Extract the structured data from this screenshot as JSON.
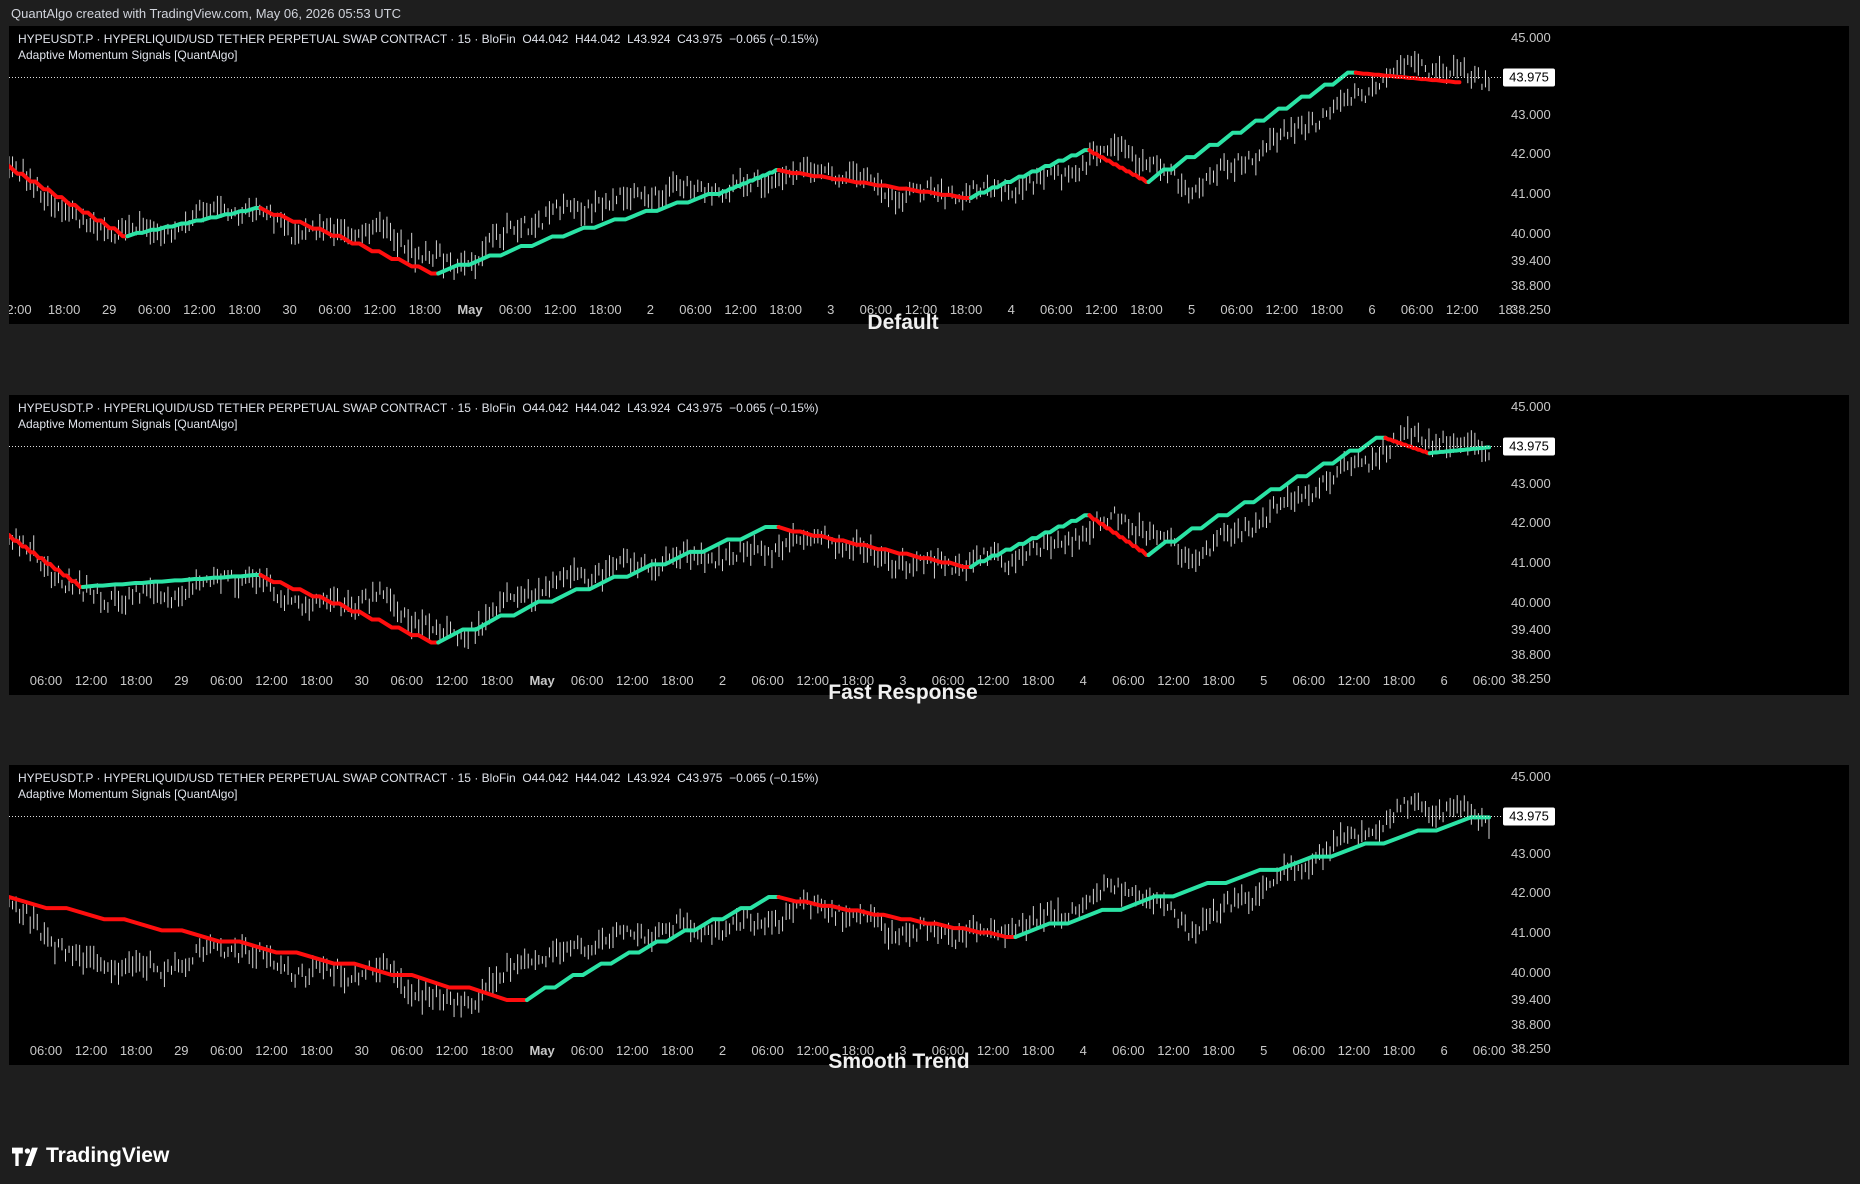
{
  "credit": "QuantAlgo created with TradingView.com, May 06, 2026 05:53 UTC",
  "brand": "TradingView",
  "colors": {
    "bull": "#2be3a5",
    "bear": "#ff0e0e",
    "price": "#d4d4d4",
    "background": "#000000"
  },
  "legend": {
    "symbol_line": "HYPEUSDT.P · HYPERLIQUID/USD TETHER PERPETUAL SWAP CONTRACT · 15 · BloFin  O44.042  H44.042  L43.924  C43.975  −0.065 (−0.15%)",
    "indicator_line": "Adaptive Momentum Signals [QuantAlgo]"
  },
  "chart_data": [
    {
      "type": "line",
      "title": "Default",
      "symbol": "HYPEUSDT.P",
      "timeframe": "15",
      "last_price": "43.975",
      "y_ticks": [
        "45.000",
        "43.000",
        "42.000",
        "41.000",
        "40.000",
        "39.400",
        "38.800",
        "38.250"
      ],
      "x_ticks": [
        "2:00",
        "18:00",
        "29",
        "06:00",
        "12:00",
        "18:00",
        "30",
        "06:00",
        "12:00",
        "18:00",
        "May",
        "06:00",
        "12:00",
        "18:00",
        "2",
        "06:00",
        "12:00",
        "18:00",
        "3",
        "06:00",
        "12:00",
        "18:00",
        "4",
        "06:00",
        "12:00",
        "18:00",
        "5",
        "06:00",
        "12:00",
        "18:00",
        "6",
        "06:00",
        "12:00",
        "18:"
      ],
      "price_series": {
        "name": "HYPEUSDT.P",
        "x": [
          0,
          0.05,
          0.1,
          0.15,
          0.2,
          0.25,
          0.3,
          0.35,
          0.4,
          0.45,
          0.5,
          0.55,
          0.6,
          0.65,
          0.7,
          0.75,
          0.8,
          0.85,
          0.9,
          0.95,
          1.0
        ],
        "y": [
          41.7,
          40.2,
          40.1,
          40.7,
          40.0,
          40.1,
          39.2,
          40.3,
          40.8,
          41.1,
          41.2,
          41.7,
          41.0,
          41.0,
          41.3,
          42.2,
          41.1,
          42.2,
          43.3,
          44.3,
          43.9
        ]
      },
      "signal_series": {
        "name": "Adaptive Momentum Signals",
        "segments": [
          {
            "state": "bear",
            "x": [
              0.0,
              0.08
            ],
            "y": [
              41.7,
              39.95
            ]
          },
          {
            "state": "bull",
            "x": [
              0.08,
              0.17
            ],
            "y": [
              39.95,
              40.65
            ]
          },
          {
            "state": "bear",
            "x": [
              0.17,
              0.29
            ],
            "y": [
              40.65,
              39.1
            ]
          },
          {
            "state": "bull",
            "x": [
              0.29,
              0.48
            ],
            "y": [
              39.1,
              41.0
            ]
          },
          {
            "state": "bull",
            "x": [
              0.48,
              0.52
            ],
            "y": [
              41.0,
              41.6
            ]
          },
          {
            "state": "bear",
            "x": [
              0.52,
              0.65
            ],
            "y": [
              41.6,
              40.9
            ]
          },
          {
            "state": "bull",
            "x": [
              0.65,
              0.73
            ],
            "y": [
              40.9,
              42.1
            ]
          },
          {
            "state": "bear",
            "x": [
              0.73,
              0.77
            ],
            "y": [
              42.1,
              41.3
            ]
          },
          {
            "state": "bull",
            "x": [
              0.77,
              0.91
            ],
            "y": [
              41.3,
              44.1
            ]
          },
          {
            "state": "bear",
            "x": [
              0.91,
              0.98
            ],
            "y": [
              44.1,
              43.85
            ]
          }
        ]
      }
    },
    {
      "type": "line",
      "title": "Fast Response",
      "symbol": "HYPEUSDT.P",
      "timeframe": "15",
      "last_price": "43.975",
      "y_ticks": [
        "45.000",
        "43.000",
        "42.000",
        "41.000",
        "40.000",
        "39.400",
        "38.800",
        "38.250"
      ],
      "x_ticks": [
        "06:00",
        "12:00",
        "18:00",
        "29",
        "06:00",
        "12:00",
        "18:00",
        "30",
        "06:00",
        "12:00",
        "18:00",
        "May",
        "06:00",
        "12:00",
        "18:00",
        "2",
        "06:00",
        "12:00",
        "18:00",
        "3",
        "06:00",
        "12:00",
        "18:00",
        "4",
        "06:00",
        "12:00",
        "18:00",
        "5",
        "06:00",
        "12:00",
        "18:00",
        "6",
        "06:00"
      ],
      "price_series": {
        "name": "HYPEUSDT.P",
        "x": [
          0,
          0.05,
          0.1,
          0.15,
          0.2,
          0.25,
          0.3,
          0.35,
          0.4,
          0.45,
          0.5,
          0.55,
          0.6,
          0.65,
          0.7,
          0.75,
          0.8,
          0.85,
          0.9,
          0.95,
          1.0
        ],
        "y": [
          41.7,
          40.2,
          40.1,
          40.7,
          40.0,
          40.1,
          39.2,
          40.3,
          40.8,
          41.1,
          41.2,
          41.7,
          41.0,
          41.0,
          41.3,
          42.2,
          41.1,
          42.2,
          43.3,
          44.3,
          43.9
        ]
      },
      "signal_series": {
        "name": "Adaptive Momentum Signals",
        "segments": [
          {
            "state": "bear",
            "x": [
              0.0,
              0.05
            ],
            "y": [
              41.7,
              40.4
            ]
          },
          {
            "state": "bull",
            "x": [
              0.05,
              0.17
            ],
            "y": [
              40.4,
              40.7
            ]
          },
          {
            "state": "bear",
            "x": [
              0.17,
              0.29
            ],
            "y": [
              40.7,
              39.1
            ]
          },
          {
            "state": "bull",
            "x": [
              0.29,
              0.52
            ],
            "y": [
              39.1,
              41.9
            ]
          },
          {
            "state": "bear",
            "x": [
              0.52,
              0.65
            ],
            "y": [
              41.9,
              40.9
            ]
          },
          {
            "state": "bull",
            "x": [
              0.65,
              0.73
            ],
            "y": [
              40.9,
              42.2
            ]
          },
          {
            "state": "bear",
            "x": [
              0.73,
              0.77
            ],
            "y": [
              42.2,
              41.2
            ]
          },
          {
            "state": "bull",
            "x": [
              0.77,
              0.93
            ],
            "y": [
              41.2,
              44.2
            ]
          },
          {
            "state": "bear",
            "x": [
              0.93,
              0.96
            ],
            "y": [
              44.2,
              43.8
            ]
          },
          {
            "state": "bull",
            "x": [
              0.96,
              1.0
            ],
            "y": [
              43.8,
              43.95
            ]
          }
        ]
      }
    },
    {
      "type": "line",
      "title": "Smooth Trend",
      "symbol": "HYPEUSDT.P",
      "timeframe": "15",
      "last_price": "43.975",
      "y_ticks": [
        "45.000",
        "43.000",
        "42.000",
        "41.000",
        "40.000",
        "39.400",
        "38.800",
        "38.250"
      ],
      "x_ticks": [
        "06:00",
        "12:00",
        "18:00",
        "29",
        "06:00",
        "12:00",
        "18:00",
        "30",
        "06:00",
        "12:00",
        "18:00",
        "May",
        "06:00",
        "12:00",
        "18:00",
        "2",
        "06:00",
        "12:00",
        "18:00",
        "3",
        "06:00",
        "12:00",
        "18:00",
        "4",
        "06:00",
        "12:00",
        "18:00",
        "5",
        "06:00",
        "12:00",
        "18:00",
        "6",
        "06:00"
      ],
      "price_series": {
        "name": "HYPEUSDT.P",
        "x": [
          0,
          0.05,
          0.1,
          0.15,
          0.2,
          0.25,
          0.3,
          0.35,
          0.4,
          0.45,
          0.5,
          0.55,
          0.6,
          0.65,
          0.7,
          0.75,
          0.8,
          0.85,
          0.9,
          0.95,
          1.0
        ],
        "y": [
          41.7,
          40.2,
          40.1,
          40.7,
          40.0,
          40.1,
          39.2,
          40.3,
          40.8,
          41.1,
          41.2,
          41.7,
          41.0,
          41.0,
          41.3,
          42.2,
          41.1,
          42.2,
          43.3,
          44.3,
          43.9
        ]
      },
      "signal_series": {
        "name": "Adaptive Momentum Signals",
        "segments": [
          {
            "state": "bear",
            "x": [
              0.0,
              0.35
            ],
            "y": [
              41.9,
              39.4
            ]
          },
          {
            "state": "bull",
            "x": [
              0.35,
              0.52
            ],
            "y": [
              39.4,
              41.9
            ]
          },
          {
            "state": "bear",
            "x": [
              0.52,
              0.68
            ],
            "y": [
              41.9,
              40.9
            ]
          },
          {
            "state": "bull",
            "x": [
              0.68,
              1.0
            ],
            "y": [
              40.9,
              43.95
            ]
          }
        ]
      }
    }
  ]
}
